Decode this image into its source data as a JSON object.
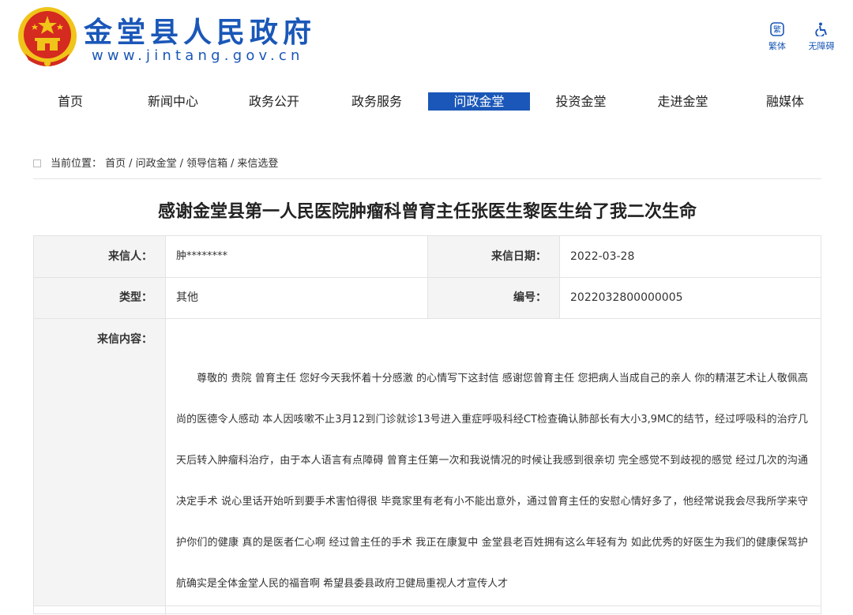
{
  "header": {
    "site_name": "金堂县人民政府",
    "site_url": "www.jintang.gov.cn",
    "tools": [
      {
        "icon": "traditional-chinese-icon",
        "label": "繁体"
      },
      {
        "icon": "accessibility-icon",
        "label": "无障碍"
      }
    ]
  },
  "nav": {
    "items": [
      {
        "label": "首页"
      },
      {
        "label": "新闻中心"
      },
      {
        "label": "政务公开"
      },
      {
        "label": "政务服务"
      },
      {
        "label": "问政金堂"
      },
      {
        "label": "投资金堂"
      },
      {
        "label": "走进金堂"
      },
      {
        "label": "融媒体"
      }
    ],
    "active_label": "问政金堂"
  },
  "breadcrumb": {
    "prefix": "当前位置：",
    "items": [
      "首页",
      "问政金堂",
      "领导信箱",
      "来信选登"
    ],
    "separator": "/"
  },
  "letter": {
    "title": "感谢金堂县第一人民医院肿瘤科曾育主任张医生黎医生给了我二次生命",
    "sender_label": "来信人：",
    "sender_value": "肿********",
    "date_label": "来信日期：",
    "date_value": "2022-03-28",
    "type_label": "类型：",
    "type_value": "其他",
    "number_label": "编号：",
    "number_value": "2022032800000005",
    "content_label": "来信内容：",
    "content_text": "尊敬的 贵院 曾育主任  您好今天我怀着十分感激 的心情写下这封信 感谢您曾育主任 您把病人当成自己的亲人 你的精湛艺术让人敬佩高尚的医德令人感动  本人因咳嗽不止3月12到门诊就诊13号进入重症呼吸科经CT检查确认肺部长有大小3,9MC的结节，经过呼吸科的治疗几天后转入肿瘤科治疗，由于本人语言有点障碍  曾育主任第一次和我说情况的时候让我感到很亲切 完全感觉不到歧视的感觉 经过几次的沟通决定手术 说心里话开始听到要手术害怕得很    毕竟家里有老有小不能出意外，通过曾育主任的安慰心情好多了，他经常说我会尽我所学来守护你们的健康  真的是医者仁心啊 经过曾主任的手术 我正在康复中  金堂县老百姓拥有这么年轻有为 如此优秀的好医生为我们的健康保驾护航确实是全体金堂人民的福音啊  希望县委县政府卫健局重视人才宣传人才"
  },
  "colors": {
    "brand_blue": "#1a57b8",
    "emblem_red": "#d42a1f",
    "emblem_gold": "#f0c419",
    "label_bg": "#f4f4f4",
    "border": "#e3e3e3"
  }
}
